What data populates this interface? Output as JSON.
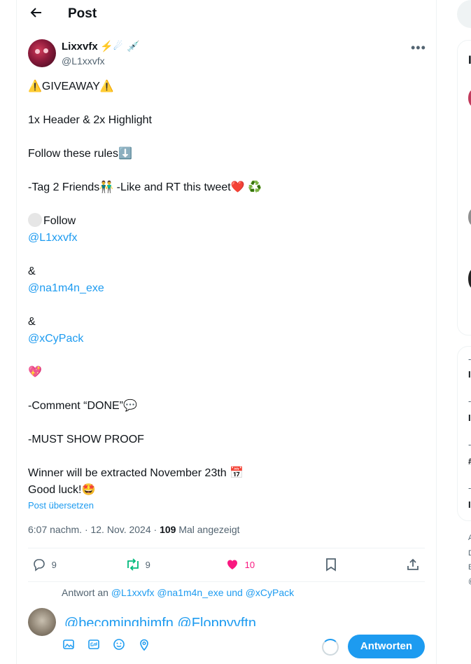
{
  "header": {
    "title": "Post"
  },
  "author": {
    "name": "Lixxvfx",
    "badges": [
      "⚡",
      "☄",
      "💉"
    ],
    "handle": "@L1xxvfx"
  },
  "tweet": {
    "lines": [
      "⚠️GIVEAWAY⚠️",
      "",
      "1x Header & 2x Highlight",
      "",
      "Follow these rules⬇️",
      "",
      "-Tag 2 Friends👬 -Like and RT this tweet❤️ ♻️",
      "",
      "Follow",
      "@L1xxvfx",
      "",
      "&",
      "@na1m4n_exe",
      "",
      "&",
      "@xCyPack",
      "",
      "💖",
      "",
      "-Comment “DONE”💬",
      "",
      "-MUST SHOW PROOF",
      "",
      "Winner will be extracted November 23th 📅",
      "Good luck!🤩"
    ],
    "translate": "Post übersetzen",
    "time": "6:07 nachm. · 12. Nov. 2024 · ",
    "views": "109",
    "views_label": " Mal angezeigt"
  },
  "actions": {
    "replies": "9",
    "reposts": "9",
    "likes": "10"
  },
  "reply": {
    "to_label": "Antwort an ",
    "to_mentions": "@L1xxvfx @na1m4n_exe",
    "and_label": " und ",
    "to_last": "@xCyPack",
    "draft": "@becominghimfn @Floppyvftn",
    "button": "Antworten"
  },
  "right_column": {
    "letters": [
      "I",
      "-",
      "I",
      "-",
      "I",
      "-",
      "#",
      "-",
      "I",
      "A",
      "D",
      "E",
      "@"
    ]
  },
  "colors": {
    "accent": "#1d9bf0",
    "like": "#f91880",
    "repost": "#00ba7c",
    "muted": "#536471"
  }
}
